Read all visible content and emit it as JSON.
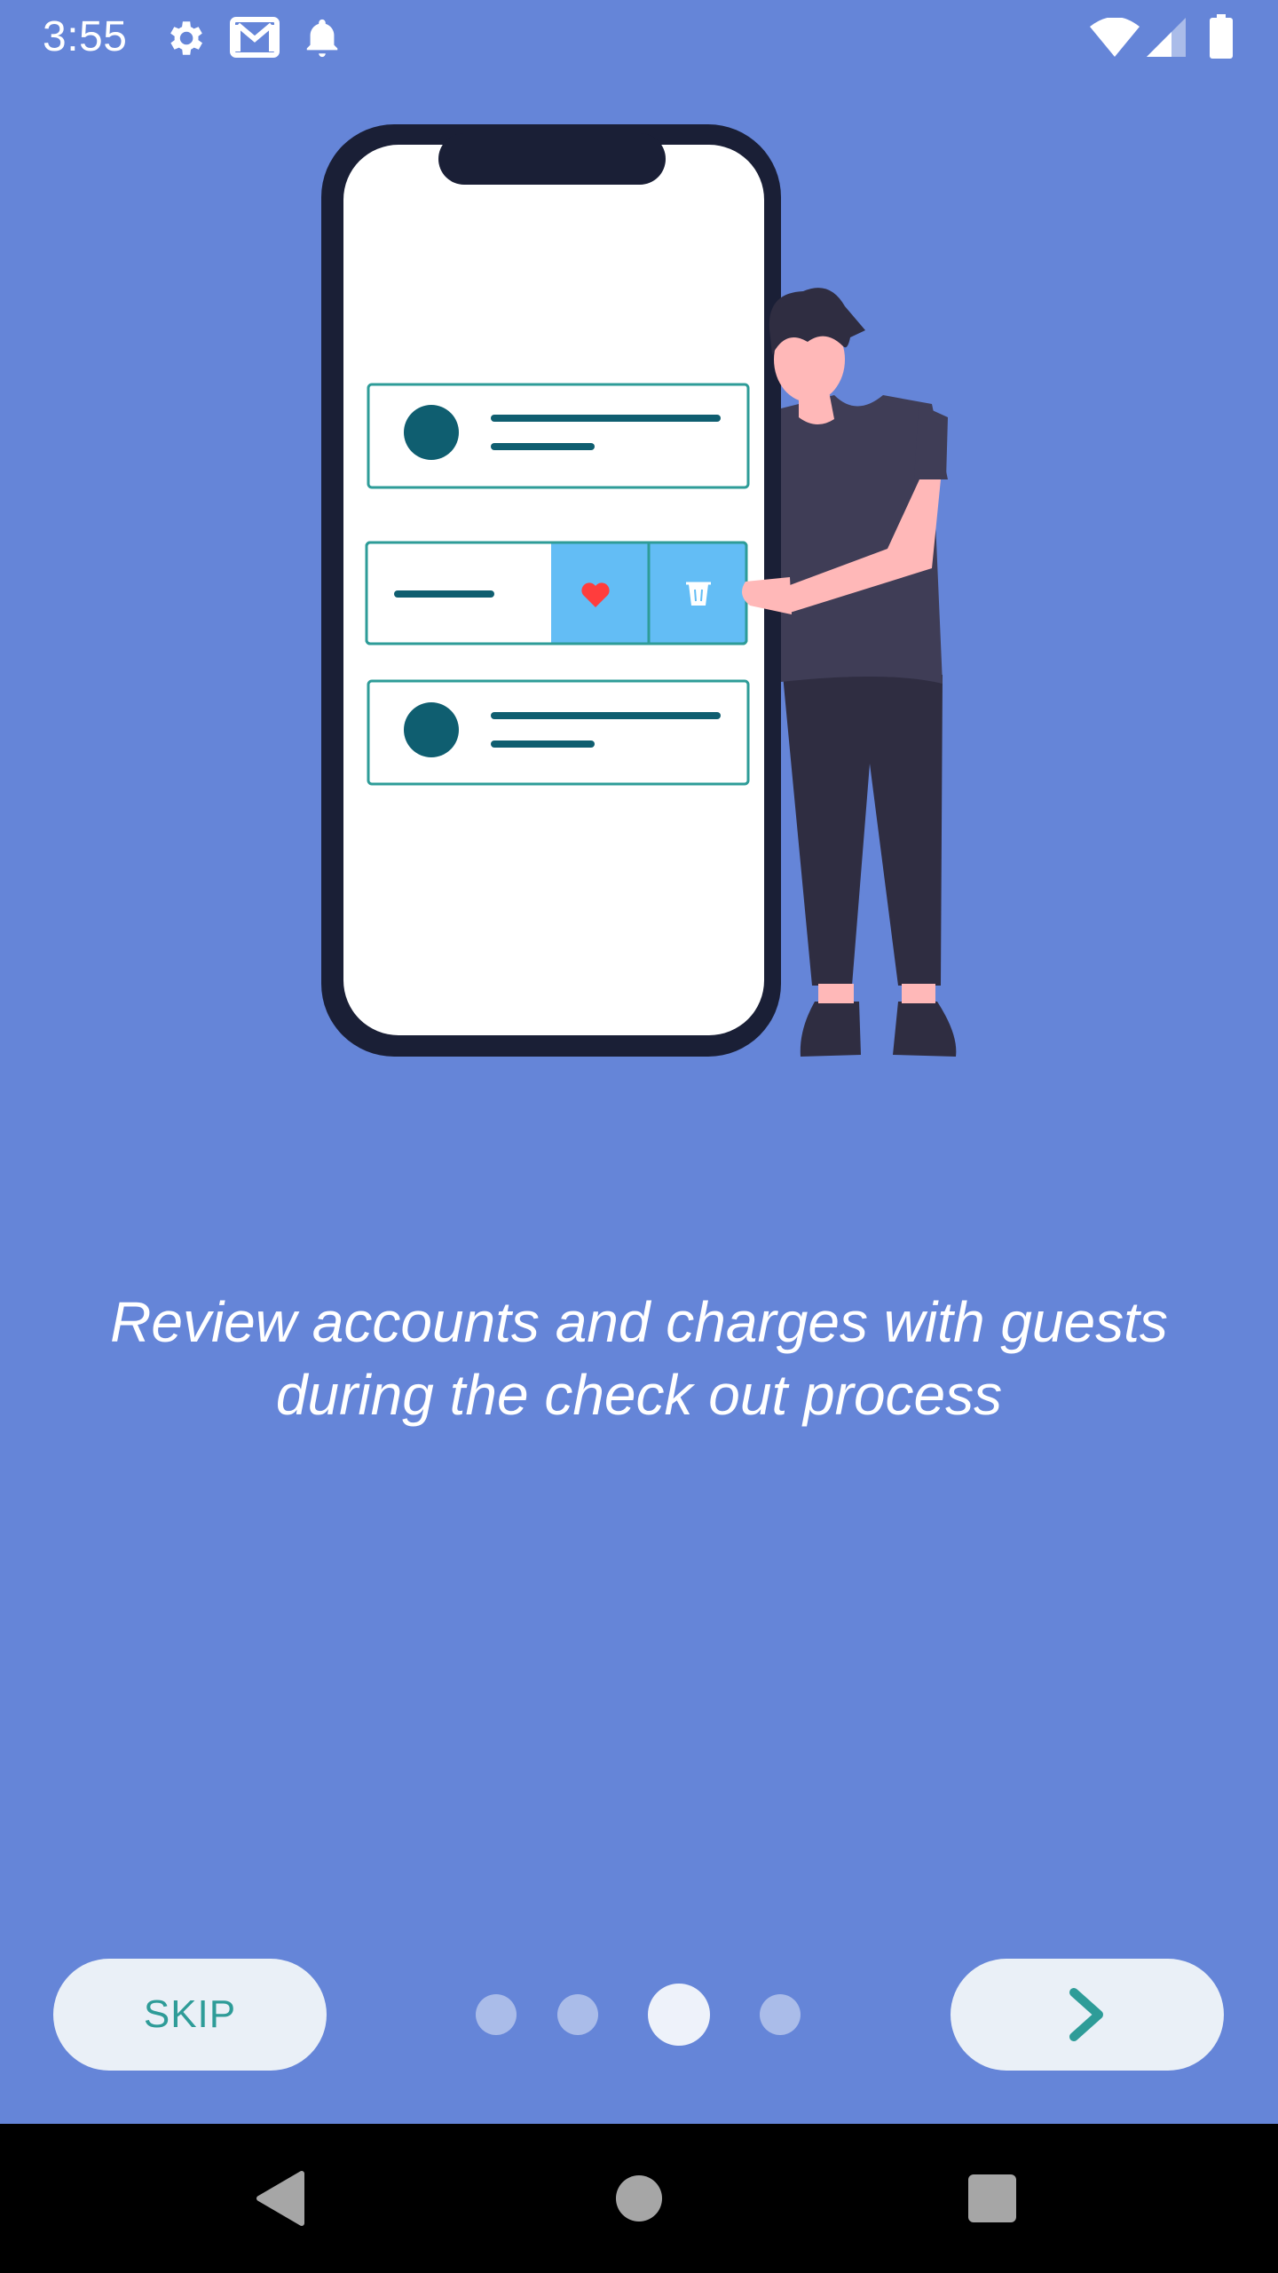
{
  "status_bar": {
    "time": "3:55",
    "left_icons": [
      "settings-icon",
      "gmail-icon",
      "notification-bell-icon"
    ],
    "right_icons": [
      "wifi-icon",
      "cell-signal-icon",
      "battery-icon"
    ]
  },
  "onboarding": {
    "illustration": "person-leaning-on-phone-with-list-items",
    "caption": "Review accounts and charges with guests during the check out process",
    "page_count": 4,
    "current_page": 3
  },
  "controls": {
    "skip_label": "SKIP",
    "next_icon": "chevron-right-icon"
  },
  "nav_bar": {
    "buttons": [
      "back-triangle-icon",
      "home-circle-icon",
      "recents-square-icon"
    ]
  },
  "colors": {
    "background": "#6585d8",
    "button_bg": "#eaf0f7",
    "accent": "#2e9c98",
    "phone_frame": "#1a1f36",
    "list_teal": "#0f5e70",
    "swipe_blue": "#63bdf5",
    "heart_red": "#ff3d3d"
  }
}
